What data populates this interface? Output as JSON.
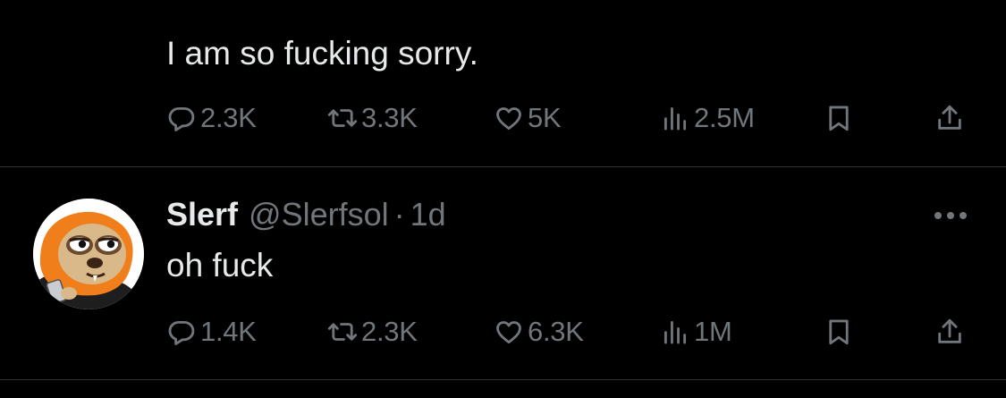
{
  "previous_tweet": {
    "text": "I am so fucking sorry.",
    "actions": {
      "replies": "2.3K",
      "reposts": "3.3K",
      "likes": "5K",
      "views": "2.5M"
    }
  },
  "reply_tweet": {
    "author": {
      "display_name": "Slerf",
      "handle": "@Slerfsol",
      "separator": "·",
      "time": "1d"
    },
    "text": "oh fuck",
    "actions": {
      "replies": "1.4K",
      "reposts": "2.3K",
      "likes": "6.3K",
      "views": "1M"
    }
  },
  "icons": {
    "reply": "reply-icon",
    "repost": "repost-icon",
    "like": "heart-icon",
    "views": "views-icon",
    "bookmark": "bookmark-icon",
    "share": "share-icon",
    "more": "more-icon"
  },
  "colors": {
    "background": "#000000",
    "text_primary": "#e7e9ea",
    "text_secondary": "#71767b",
    "divider": "#2f3336",
    "avatar_orange": "#f07f1b"
  }
}
